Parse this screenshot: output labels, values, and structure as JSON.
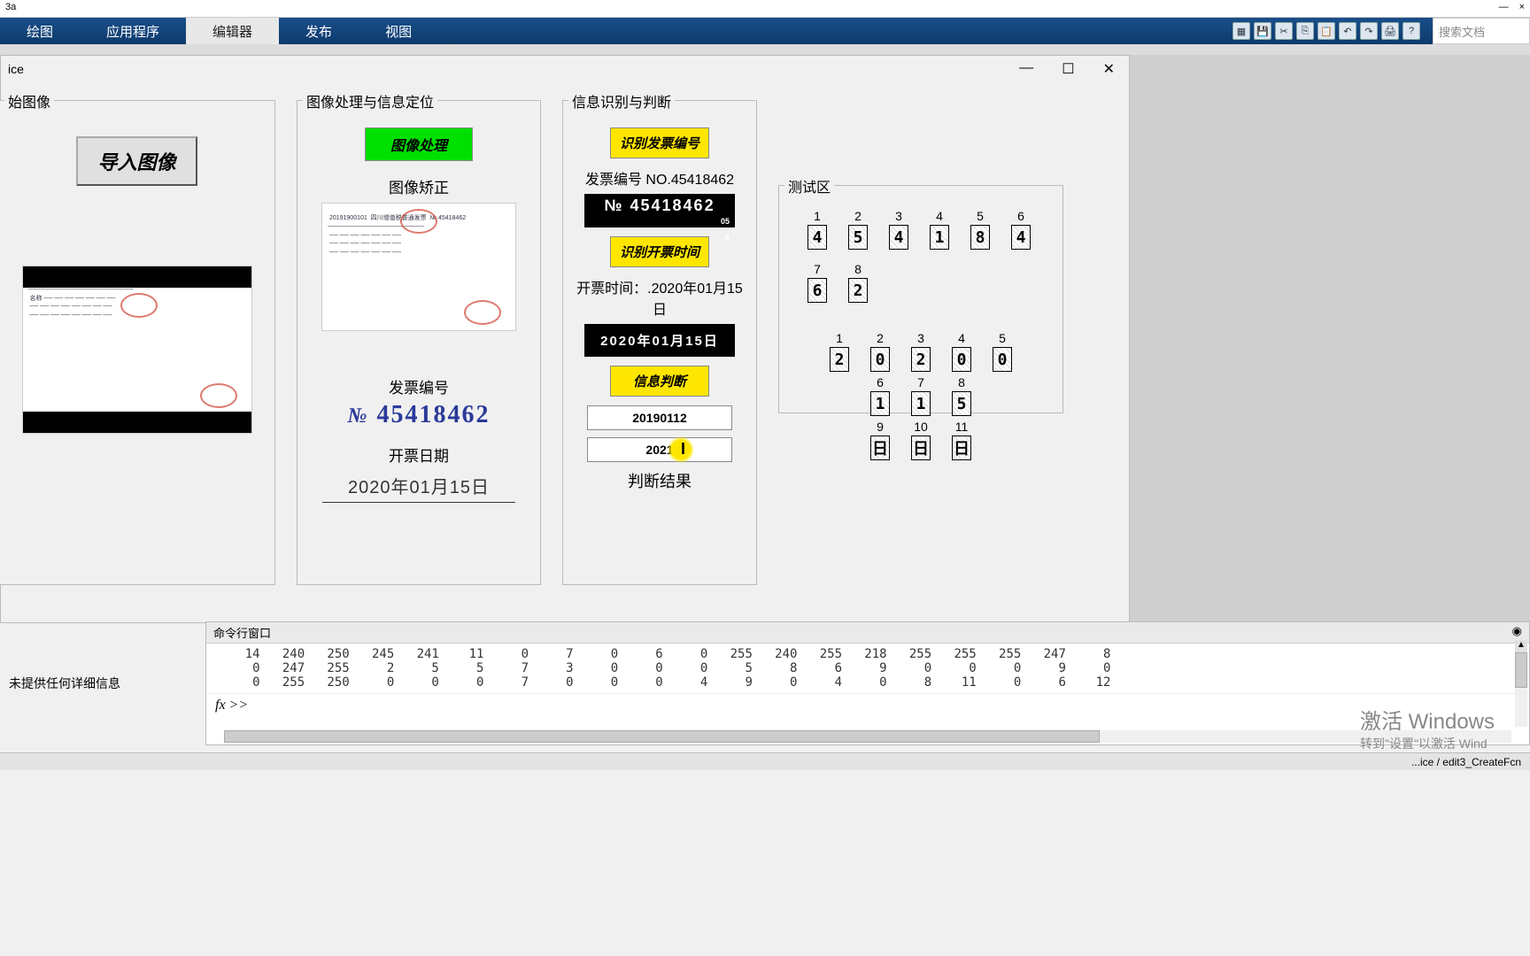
{
  "titlebar": {
    "app": "3a",
    "min": "—",
    "close": "×"
  },
  "ribbon": {
    "tabs": [
      "绘图",
      "应用程序",
      "编辑器",
      "发布",
      "视图"
    ],
    "active": 2,
    "search_placeholder": "搜索文档"
  },
  "dialog": {
    "title": "ice",
    "panel1": {
      "title": "始图像",
      "button": "导入图像"
    },
    "panel2": {
      "title": "图像处理与信息定位",
      "button": "图像处理",
      "correction_label": "图像矫正",
      "invoice_no_label": "发票编号",
      "invoice_no_prefix": "№",
      "invoice_no": "45418462",
      "date_label": "开票日期",
      "date_value": "2020年01月15日"
    },
    "panel3": {
      "title": "信息识别与判断",
      "btn_recognize_no": "识别发票编号",
      "invoice_no_text": "发票编号 NO.45418462",
      "strip_no": "№ 45418462",
      "btn_recognize_date": "识别开票时间",
      "date_text": "开票时间：.2020年01月15日",
      "strip_date": "2020年01月15日",
      "btn_judge": "信息判断",
      "input1": "20190112",
      "input2": "2021",
      "result_label": "判断结果"
    },
    "panel4": {
      "title": "测试区",
      "row1_idx": [
        "1",
        "2",
        "3",
        "4",
        "5",
        "6",
        "7",
        "8"
      ],
      "row1_digits": [
        "4",
        "5",
        "4",
        "1",
        "8",
        "4",
        "6",
        "2"
      ],
      "row2_idx": [
        "1",
        "2",
        "3",
        "4",
        "5"
      ],
      "row2_digits": [
        "2",
        "0",
        "2",
        "0",
        "0"
      ],
      "row3_idx": [
        "6",
        "7",
        "8"
      ],
      "row3_digits": [
        "1",
        "1",
        "5"
      ],
      "row4_idx": [
        "9",
        "10",
        "11"
      ],
      "row4_digits": [
        "日",
        "日",
        "日"
      ]
    }
  },
  "cmd": {
    "title": "命令行窗口",
    "rows": [
      "    14   240   250   245   241    11     0     7     0     6     0   255   240   255   218   255   255   255   247     8",
      "     0   247   255     2     5     5     7     3     0     0     0     5     8     6     9     0     0     0     9     0",
      "     0   255   250     0     0     0     7     0     0     0     4     9     0     4     0     8    11     0     6    12"
    ],
    "prompt": "fx  >>"
  },
  "info_left": "未提供任何详细信息",
  "watermark": {
    "main": "激活 Windows",
    "sub": "转到\"设置\"以激活 Wind"
  },
  "statusbar": "...ice / edit3_CreateFcn"
}
